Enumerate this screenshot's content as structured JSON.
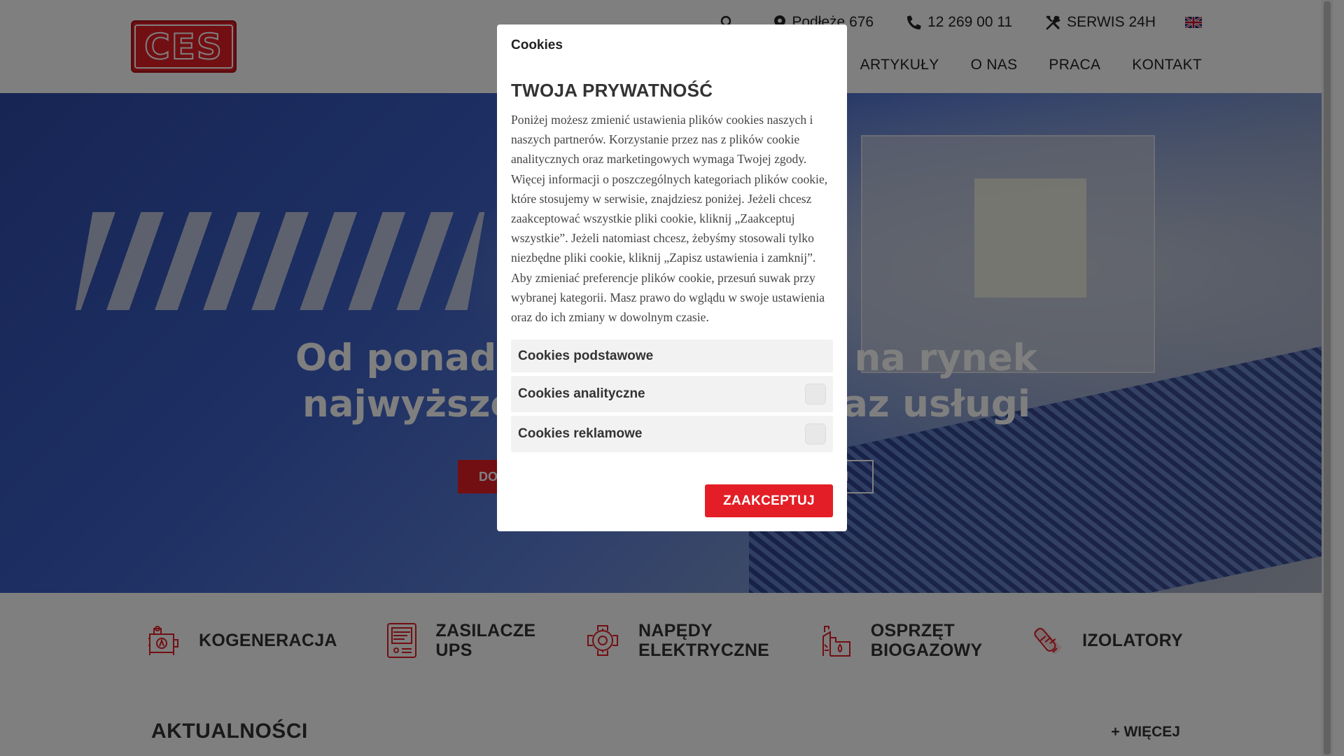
{
  "brand": {
    "logo_text": "CES",
    "accent": "#e41e26"
  },
  "topbar": {
    "address": "Podłęże 676",
    "phone": "12 269 00 11",
    "service": "SERWIS 24H",
    "icons": [
      "search-icon",
      "map-pin-icon",
      "phone-icon",
      "tools-icon",
      "uk-flag-icon"
    ]
  },
  "nav": {
    "items": [
      {
        "label": "ARTYKUŁY"
      },
      {
        "label": "O NAS"
      },
      {
        "label": "PRACA"
      },
      {
        "label": "KONTAKT"
      }
    ]
  },
  "hero": {
    "title_line1": "Od ponad",
    "title_line1_right": "na rynek",
    "title_line2_left": "najwyższe",
    "title_line2_right": "raz usługi",
    "btn_red": "DO",
    "btn_outline": "I"
  },
  "categories": [
    {
      "label": "KOGENERACJA",
      "icon": "cogeneration-icon"
    },
    {
      "label": "ZASILACZE\nUPS",
      "icon": "ups-icon"
    },
    {
      "label": "NAPĘDY\nELEKTRYCZNE",
      "icon": "electric-motor-icon"
    },
    {
      "label": "OSPRZĘT\nBIOGAZOWY",
      "icon": "biogas-icon"
    },
    {
      "label": "IZOLATORY",
      "icon": "insulator-icon"
    }
  ],
  "news": {
    "title": "AKTUALNOŚCI",
    "more": "+ WIĘCEJ"
  },
  "cookie_modal": {
    "header": "Cookies",
    "title": "TWOJA PRYWATNOŚĆ",
    "description": "Poniżej możesz zmienić ustawienia plików cookies naszych i naszych partnerów. Korzystanie przez nas z plików cookie analitycznych oraz marketingowych wymaga Twojej zgody. Więcej informacji o poszczególnych kategoriach plików cookie, które stosujemy w serwisie, znajdziesz poniżej. Jeżeli chcesz zaakceptować wszystkie pliki cookie, kliknij „Zaakceptuj wszystkie”. Jeżeli natomiast chcesz, żebyśmy stosowali tylko niezbędne pliki cookie, kliknij „Zapisz ustawienia i zamknij”. Aby zmieniać preferencje plików cookie, przesuń suwak przy wybranej kategorii. Masz prawo do wglądu w swoje ustawienia oraz do ich zmiany w dowolnym czasie.",
    "categories": [
      {
        "label": "Cookies podstawowe",
        "toggle": false
      },
      {
        "label": "Cookies analityczne",
        "toggle": true,
        "enabled": false
      },
      {
        "label": "Cookies reklamowe",
        "toggle": true,
        "enabled": false
      }
    ],
    "accept_label": "ZAAKCEPTUJ"
  }
}
